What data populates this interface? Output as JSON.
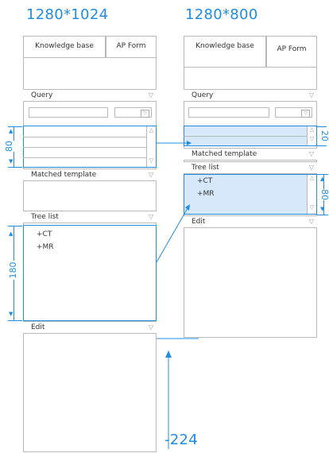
{
  "left": {
    "title": "1280*1024",
    "tabs": [
      "Knowledge base",
      "AP Form"
    ],
    "sections": {
      "query": "Query",
      "matched_template": "Matched template",
      "tree_list": "Tree list",
      "edit": "Edit"
    },
    "tree_items": [
      "+CT",
      "+MR"
    ],
    "dims": {
      "query_area": "80",
      "tree_area": "180"
    }
  },
  "right": {
    "title": "1280*800",
    "tabs": [
      "Knowledge base",
      "AP Form"
    ],
    "sections": {
      "query": "Query",
      "matched_template": "Matched template",
      "tree_list": "Tree list",
      "edit": "Edit"
    },
    "tree_items": [
      "+CT",
      "+MR"
    ],
    "dims": {
      "query_area": "20",
      "tree_area": "80"
    }
  },
  "annotation": {
    "delta": "-224"
  },
  "colors": {
    "accent": "#1f8de4",
    "highlight": "#d7e8fb",
    "border": "#b9b9b9"
  }
}
